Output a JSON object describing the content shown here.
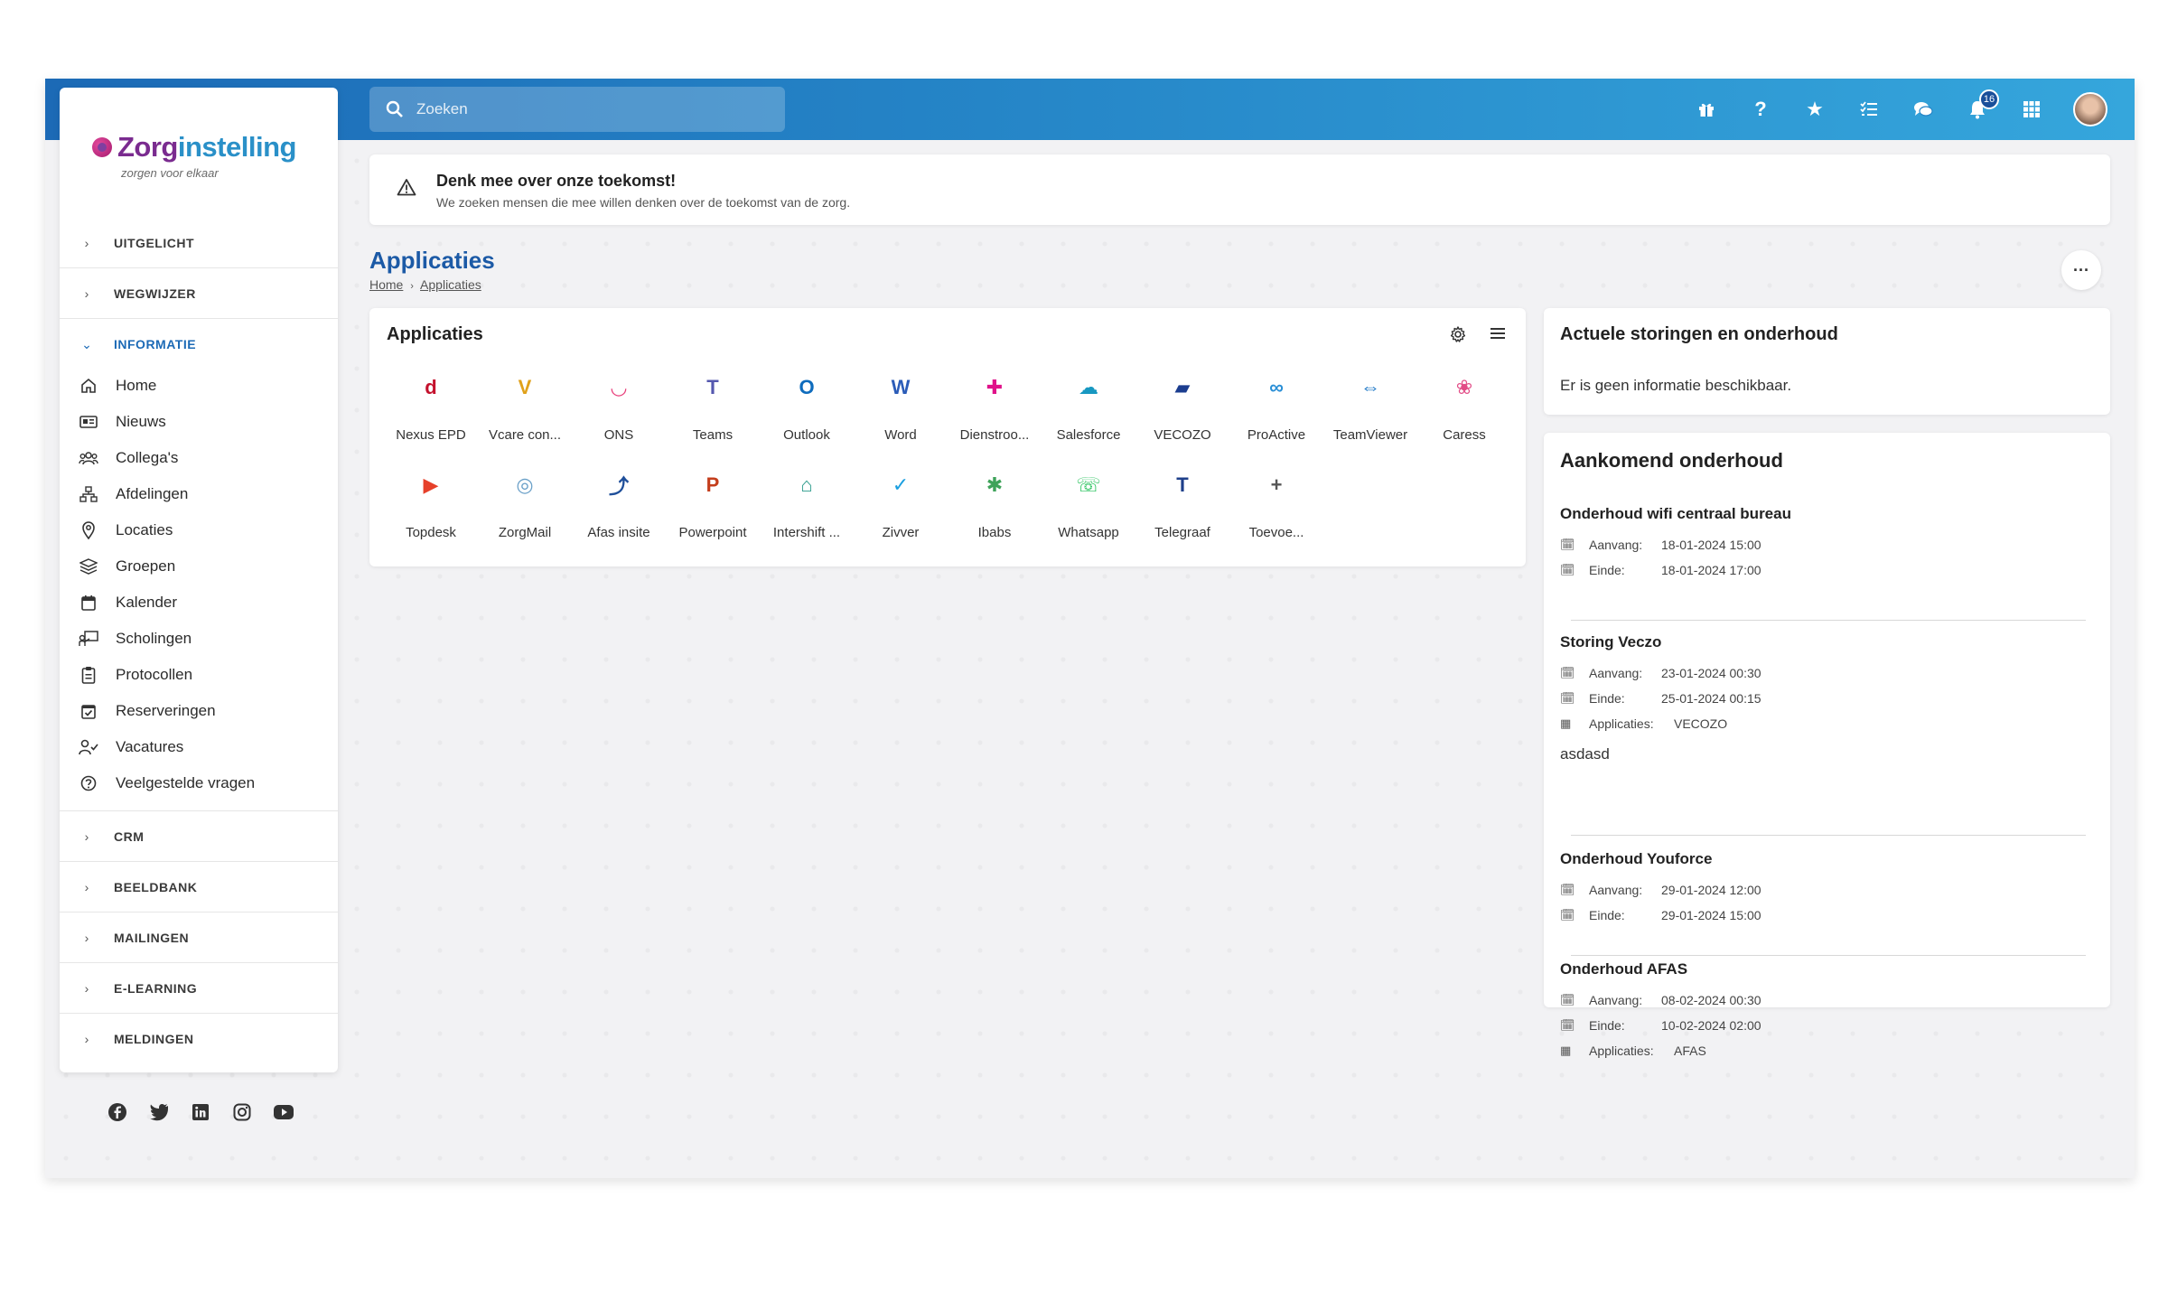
{
  "logo": {
    "brand_a": "Zorg",
    "brand_b": "instelling",
    "tagline": "zorgen voor elkaar"
  },
  "search": {
    "placeholder": "Zoeken"
  },
  "notifications": {
    "count": "16"
  },
  "sidebar": {
    "sections_top": [
      {
        "label": "UITGELICHT"
      },
      {
        "label": "WEGWIJZER"
      },
      {
        "label": "INFORMATIE"
      }
    ],
    "items": [
      {
        "label": "Home",
        "icon": "home-icon"
      },
      {
        "label": "Nieuws",
        "icon": "newspaper-icon"
      },
      {
        "label": "Collega's",
        "icon": "users-icon"
      },
      {
        "label": "Afdelingen",
        "icon": "sitemap-icon"
      },
      {
        "label": "Locaties",
        "icon": "map-pin-icon"
      },
      {
        "label": "Groepen",
        "icon": "layers-icon"
      },
      {
        "label": "Kalender",
        "icon": "calendar-icon"
      },
      {
        "label": "Scholingen",
        "icon": "training-icon"
      },
      {
        "label": "Protocollen",
        "icon": "clipboard-icon"
      },
      {
        "label": "Reserveringen",
        "icon": "calendar-check-icon"
      },
      {
        "label": "Vacatures",
        "icon": "user-check-icon"
      },
      {
        "label": "Veelgestelde vragen",
        "icon": "question-circle-icon"
      }
    ],
    "sections_bottom": [
      {
        "label": "CRM"
      },
      {
        "label": "BEELDBANK"
      },
      {
        "label": "MAILINGEN"
      },
      {
        "label": "E-LEARNING"
      },
      {
        "label": "MELDINGEN"
      }
    ]
  },
  "banner": {
    "title": "Denk mee over onze toekomst!",
    "subtitle": "We zoeken mensen die mee willen denken over de toekomst van de zorg."
  },
  "page": {
    "title": "Applicaties",
    "crumb_home": "Home",
    "crumb_current": "Applicaties"
  },
  "apps_card": {
    "title": "Applicaties",
    "apps": [
      {
        "name": "Nexus EPD",
        "glyph": "d",
        "color": "#c4112d"
      },
      {
        "name": "Vcare con...",
        "glyph": "V",
        "color": "#e0a11a"
      },
      {
        "name": "ONS",
        "glyph": "◡",
        "color": "#e83e7a"
      },
      {
        "name": "Teams",
        "glyph": "T",
        "color": "#5558af"
      },
      {
        "name": "Outlook",
        "glyph": "O",
        "color": "#0f6cbd"
      },
      {
        "name": "Word",
        "glyph": "W",
        "color": "#2b5cb8"
      },
      {
        "name": "Dienstroo...",
        "glyph": "✚",
        "color": "#e0128a"
      },
      {
        "name": "Salesforce",
        "glyph": "☁",
        "color": "#1798c1"
      },
      {
        "name": "VECOZO",
        "glyph": "▰",
        "color": "#1b3d8f"
      },
      {
        "name": "ProActive",
        "glyph": "∞",
        "color": "#2a8fd6"
      },
      {
        "name": "TeamViewer",
        "glyph": "⇔",
        "color": "#0e6ec2"
      },
      {
        "name": "Caress",
        "glyph": "❀",
        "color": "#e24b86"
      },
      {
        "name": "Topdesk",
        "glyph": "▶",
        "color": "#e6402a"
      },
      {
        "name": "ZorgMail",
        "glyph": "◎",
        "color": "#6aa0c8"
      },
      {
        "name": "Afas insite",
        "glyph": "⤴",
        "color": "#1f4f9a"
      },
      {
        "name": "Powerpoint",
        "glyph": "P",
        "color": "#c43e1c"
      },
      {
        "name": "Intershift ...",
        "glyph": "⌂",
        "color": "#2a9a8a"
      },
      {
        "name": "Zivver",
        "glyph": "✓",
        "color": "#1a9fe0"
      },
      {
        "name": "Ibabs",
        "glyph": "✱",
        "color": "#3fa35a"
      },
      {
        "name": "Whatsapp",
        "glyph": "☏",
        "color": "#25c25a"
      },
      {
        "name": "Telegraaf",
        "glyph": "T",
        "color": "#1e3f8a"
      },
      {
        "name": "Toevoe...",
        "glyph": "+",
        "color": "#555555"
      }
    ]
  },
  "storingen": {
    "title": "Actuele storingen en onderhoud",
    "empty_text": "Er is geen informatie beschikbaar."
  },
  "onderhoud": {
    "title": "Aankomend onderhoud",
    "label_start": "Aanvang:",
    "label_end": "Einde:",
    "label_apps": "Applicaties:",
    "items": [
      {
        "title": "Onderhoud wifi centraal bureau",
        "start": "18-01-2024 15:00",
        "end": "18-01-2024 17:00"
      },
      {
        "title": "Storing Veczo",
        "start": "23-01-2024 00:30",
        "end": "25-01-2024 00:15",
        "apps": "VECOZO",
        "note": "asdasd"
      },
      {
        "title": "Onderhoud Youforce",
        "start": "29-01-2024 12:00",
        "end": "29-01-2024 15:00"
      },
      {
        "title": "Onderhoud AFAS",
        "start": "08-02-2024 00:30",
        "end": "10-02-2024 02:00",
        "apps": "AFAS"
      }
    ]
  }
}
